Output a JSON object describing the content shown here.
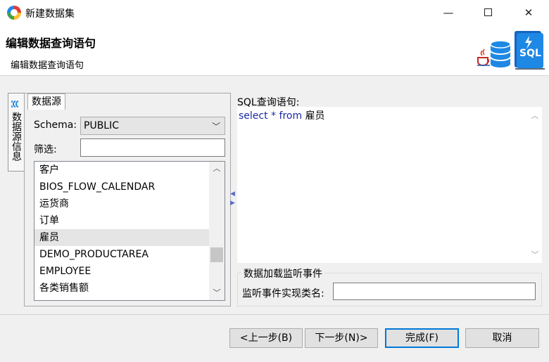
{
  "window": {
    "title": "新建数据集",
    "minimize_glyph": "—",
    "close_glyph": "✕"
  },
  "header": {
    "title": "编辑数据查询语句",
    "subtitle": "编辑数据查询语句",
    "logo_text": "SQL",
    "icon_names": [
      "java-icon",
      "database-icon",
      "sql-document-icon",
      "lightning-icon"
    ]
  },
  "sidetab": {
    "label": "数据源信息",
    "icon": "datasource-icon"
  },
  "datasource": {
    "tab_label": "数据源",
    "schema_label": "Schema:",
    "schema_value": "PUBLIC",
    "filter_label": "筛选:",
    "filter_value": "",
    "tables": [
      "客户",
      "BIOS_FLOW_CALENDAR",
      "运货商",
      "订单",
      "雇员",
      "DEMO_PRODUCTAREA",
      "EMPLOYEE",
      "各类销售额"
    ],
    "selected_index": 4
  },
  "sql": {
    "label": "SQL查询语句:",
    "keyword_select": "select",
    "star": "*",
    "keyword_from": "from",
    "table": "雇员"
  },
  "events": {
    "legend": "数据加载监听事件",
    "class_label": "监听事件实现类名:",
    "class_value": ""
  },
  "buttons": {
    "prev": "<上一步(B)",
    "next": "下一步(N)>",
    "finish": "完成(F)",
    "cancel": "取消"
  },
  "colors": {
    "accent": "#0078d7",
    "sql_keyword": "#1a2aa6",
    "selection": "#e5e5e5"
  }
}
